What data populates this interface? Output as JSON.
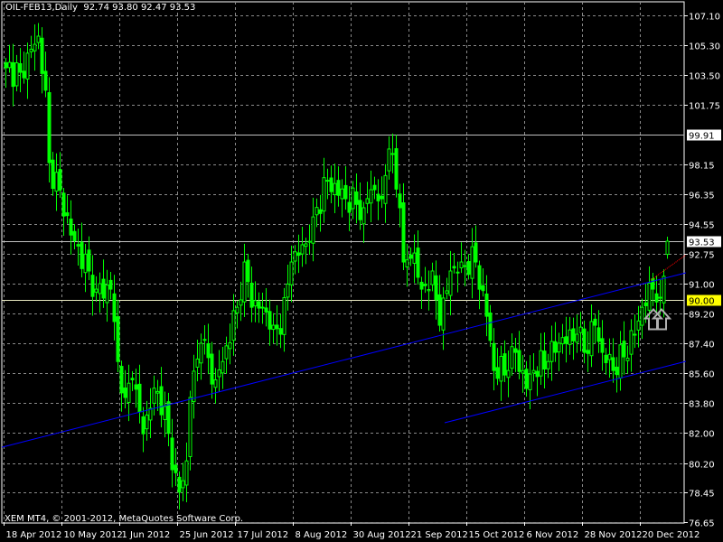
{
  "header": {
    "symbol": "OIL-FEB13,Daily",
    "ohlc": "92.74 93.80 92.47 93.53"
  },
  "footer": {
    "copyright": "XEM MT4, © 2001-2012, MetaQuotes Software Corp."
  },
  "colors": {
    "background": "#000000",
    "candle": "#00ff00",
    "grid": "#8a8a8a",
    "trend": "#0000ff",
    "projection": "#ff0000",
    "level_line": "#c0c0c0",
    "highlight_90": "#ffff00"
  },
  "chart_data": {
    "type": "candlestick",
    "title": "OIL-FEB13,Daily",
    "ylim": [
      76.65,
      107.1
    ],
    "y_ticks": [
      "107.10",
      "105.30",
      "103.50",
      "101.75",
      "98.15",
      "96.35",
      "94.55",
      "92.75",
      "91.00",
      "89.20",
      "87.40",
      "85.60",
      "83.80",
      "82.00",
      "80.20",
      "78.45",
      "76.65"
    ],
    "y_tick_values": [
      107.1,
      105.3,
      103.5,
      101.75,
      98.15,
      96.35,
      94.55,
      92.75,
      91.0,
      89.2,
      87.4,
      85.6,
      83.8,
      82.0,
      80.2,
      78.45,
      76.65
    ],
    "x_ticks": [
      "18 Apr 2012",
      "10 May 2012",
      "1 Jun 2012",
      "25 Jun 2012",
      "17 Jul 2012",
      "8 Aug 2012",
      "30 Aug 2012",
      "21 Sep 2012",
      "15 Oct 2012",
      "6 Nov 2012",
      "28 Nov 2012",
      "20 Dec 2012"
    ],
    "x_tick_every_bars": 16,
    "bar_count": 184,
    "close_waypoints": [
      [
        0,
        103.95
      ],
      [
        4,
        103.68
      ],
      [
        9,
        105.85
      ],
      [
        11,
        102.6
      ],
      [
        12,
        98.25
      ],
      [
        15,
        96.6
      ],
      [
        18,
        93.9
      ],
      [
        23,
        91.74
      ],
      [
        25,
        90.65
      ],
      [
        29,
        90.65
      ],
      [
        31,
        86.3
      ],
      [
        33,
        84.14
      ],
      [
        35,
        85.2
      ],
      [
        38,
        81.96
      ],
      [
        41,
        84.7
      ],
      [
        44,
        83.6
      ],
      [
        46,
        79.8
      ],
      [
        48,
        78.45
      ],
      [
        50,
        80.33
      ],
      [
        51,
        84.14
      ],
      [
        54,
        87.4
      ],
      [
        58,
        85.2
      ],
      [
        60,
        86.3
      ],
      [
        64,
        89.56
      ],
      [
        66,
        92.28
      ],
      [
        68,
        89.56
      ],
      [
        71,
        89.56
      ],
      [
        74,
        88.48
      ],
      [
        76,
        87.94
      ],
      [
        79,
        92.28
      ],
      [
        83,
        93.37
      ],
      [
        85,
        94.99
      ],
      [
        89,
        97.16
      ],
      [
        94,
        96.08
      ],
      [
        99,
        95.54
      ],
      [
        101,
        96.62
      ],
      [
        104,
        96.08
      ],
      [
        106,
        99.07
      ],
      [
        109,
        95.54
      ],
      [
        110,
        92.28
      ],
      [
        113,
        92.82
      ],
      [
        115,
        90.65
      ],
      [
        118,
        91.74
      ],
      [
        120,
        88.48
      ],
      [
        123,
        91.74
      ],
      [
        126,
        92.28
      ],
      [
        130,
        92.28
      ],
      [
        133,
        89.02
      ],
      [
        135,
        85.76
      ],
      [
        139,
        85.76
      ],
      [
        141,
        86.85
      ],
      [
        144,
        84.68
      ],
      [
        146,
        85.76
      ],
      [
        150,
        86.3
      ],
      [
        153,
        87.4
      ],
      [
        158,
        87.94
      ],
      [
        160,
        86.85
      ],
      [
        163,
        88.48
      ],
      [
        165,
        86.85
      ],
      [
        168,
        85.76
      ],
      [
        171,
        86.58
      ],
      [
        174,
        87.94
      ],
      [
        176,
        89.56
      ],
      [
        179,
        90.65
      ],
      [
        181,
        90.11
      ],
      [
        183,
        93.53
      ]
    ],
    "last_bar": {
      "open": 92.74,
      "high": 93.8,
      "low": 92.47,
      "close": 93.53
    },
    "levels": [
      {
        "label": "99.91",
        "price": 99.91,
        "style": "white"
      },
      {
        "label": "93.53",
        "price": 93.53,
        "style": "white"
      },
      {
        "label": "90.00",
        "price": 90.0,
        "style": "yellow"
      }
    ],
    "trendlines": [
      {
        "name": "upper-channel",
        "from": [
          -1,
          81.15
        ],
        "to": [
          188.25,
          91.63
        ],
        "color": "#0000ff"
      },
      {
        "name": "lower-channel",
        "from": [
          121.5,
          82.62
        ],
        "to": [
          188.25,
          86.31
        ],
        "color": "#0000ff"
      },
      {
        "name": "projection",
        "from": [
          178.5,
          91.19
        ],
        "to": [
          188.25,
          92.71
        ],
        "color": "#ff0000",
        "dotted": true
      }
    ],
    "buy_arrow": {
      "bar": 180,
      "price": 89.0
    }
  }
}
